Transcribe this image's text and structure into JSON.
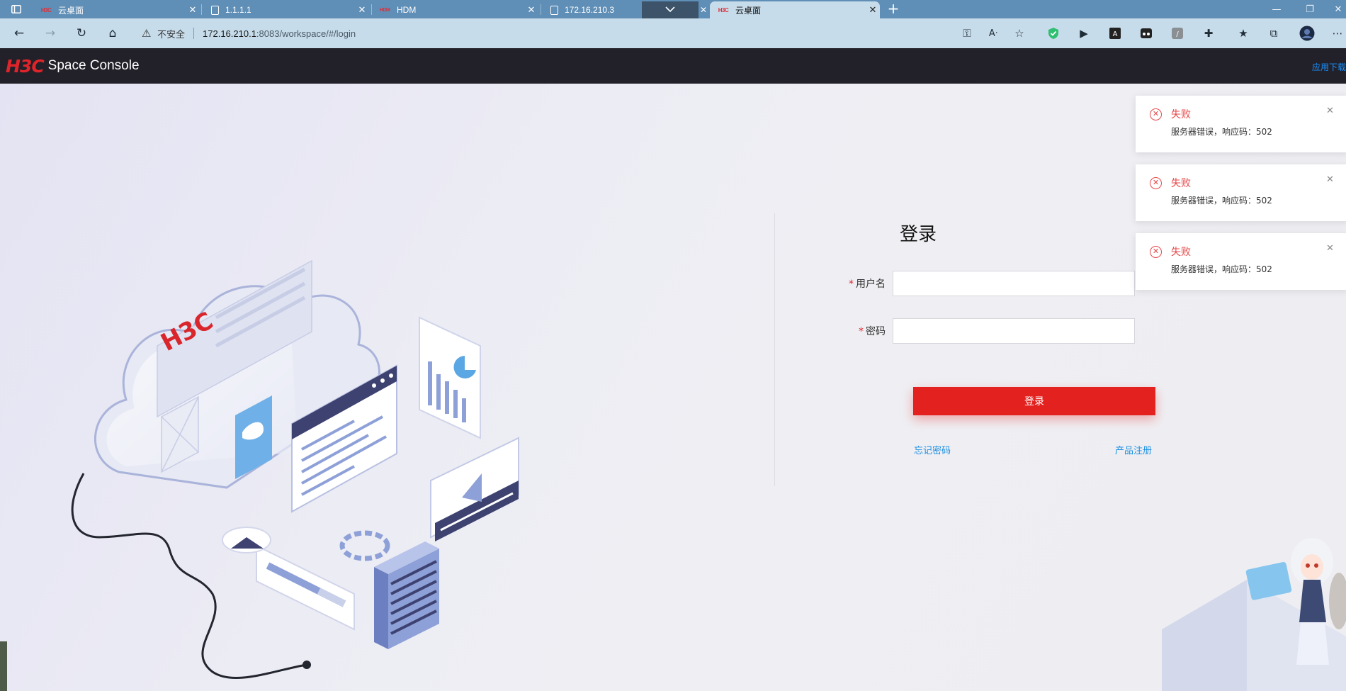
{
  "browser": {
    "tabs": [
      {
        "title": "云桌面",
        "favicon": "h3c-logo-icon",
        "active": false
      },
      {
        "title": "1.1.1.1",
        "favicon": "page-icon",
        "active": false
      },
      {
        "title": "HDM",
        "favicon": "hdm-logo-icon",
        "active": false
      },
      {
        "title": "172.16.210.3",
        "favicon": "page-icon",
        "active": false
      },
      {
        "title": "云桌面",
        "favicon": "h3c-logo-icon",
        "active": true
      }
    ],
    "address": {
      "security_label": "不安全",
      "url_host": "172.16.210.1",
      "url_rest": ":8083/workspace/#/login"
    }
  },
  "header": {
    "brand": "H3C",
    "product": "Space Console",
    "download_link": "应用下载"
  },
  "login": {
    "title": "登录",
    "username_label": "用户名",
    "password_label": "密码",
    "required_mark": "*",
    "submit_label": "登录",
    "forgot_link": "忘记密码",
    "register_link": "产品注册"
  },
  "illustration": {
    "cloud_brand": "H3C"
  },
  "notifications": [
    {
      "title": "失败",
      "message": "服务器错误，响应码：502"
    },
    {
      "title": "失败",
      "message": "服务器错误，响应码：502"
    },
    {
      "title": "失败",
      "message": "服务器错误，响应码：502"
    }
  ],
  "colors": {
    "brand_red": "#e3211f",
    "header_bg": "#222129",
    "link_blue": "#1a8ee0",
    "error_red": "#e84749",
    "tabstrip_bg": "#5f8eb6",
    "addressbar_bg": "#c7dcea"
  }
}
